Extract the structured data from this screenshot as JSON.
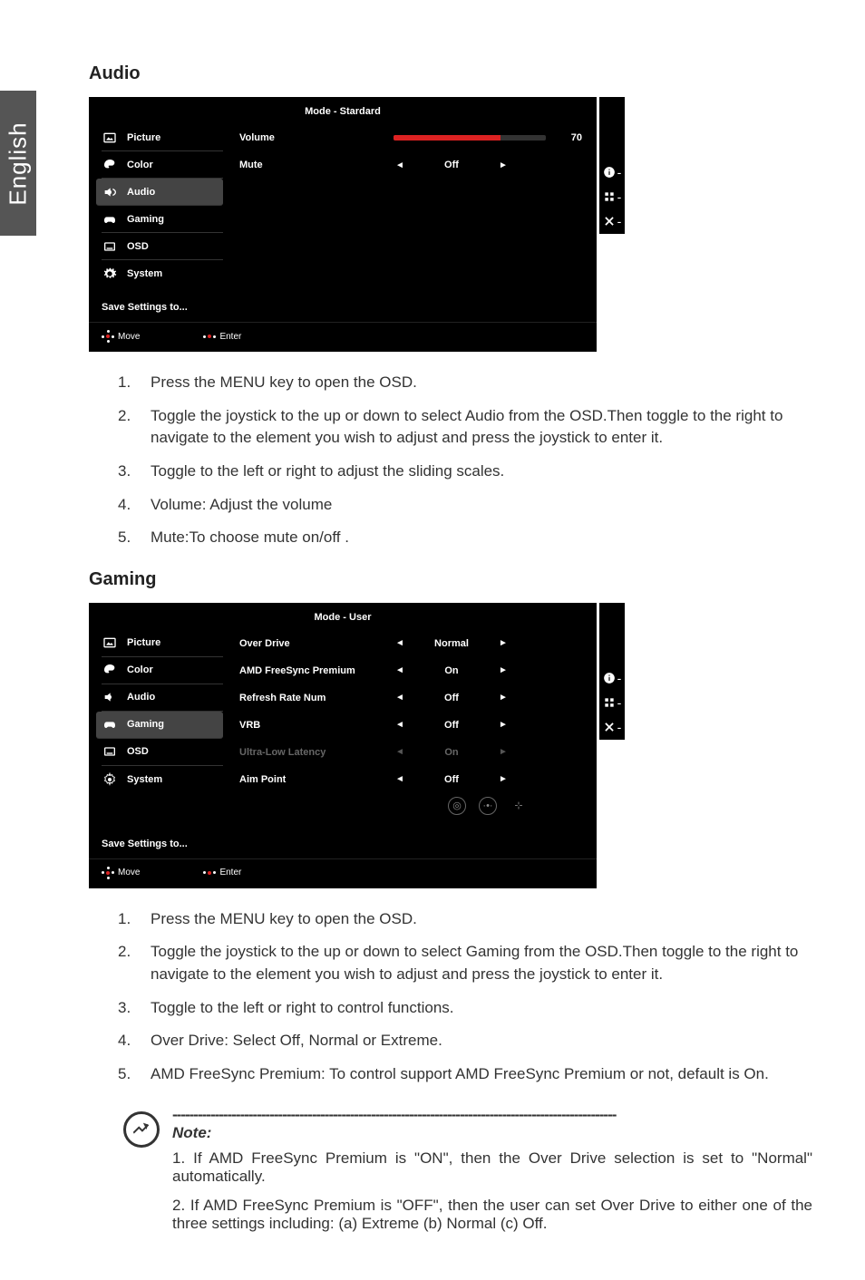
{
  "side_tab": "English",
  "audio_section": {
    "title": "Audio",
    "osd": {
      "mode": "Mode - Stardard",
      "menu": [
        {
          "name": "picture",
          "label": "Picture"
        },
        {
          "name": "color",
          "label": "Color"
        },
        {
          "name": "audio",
          "label": "Audio",
          "selected": true
        },
        {
          "name": "gaming",
          "label": "Gaming"
        },
        {
          "name": "osd",
          "label": "OSD"
        },
        {
          "name": "system",
          "label": "System"
        }
      ],
      "rows": {
        "volume": {
          "label": "Volume",
          "value": "70",
          "percent": 70
        },
        "mute": {
          "label": "Mute",
          "left": "◄",
          "value": "Off",
          "right": "►"
        }
      },
      "save": "Save Settings to...",
      "footer": {
        "move": "Move",
        "enter": "Enter"
      }
    },
    "steps": [
      "Press the MENU key to open the OSD.",
      "Toggle the joystick to the up or down to select Audio from the OSD.Then toggle to the right to navigate to the element you wish to adjust and press the joystick to enter it.",
      "Toggle to the left or right to adjust the sliding scales.",
      "Volume: Adjust the volume",
      "Mute:To choose mute on/off ."
    ]
  },
  "gaming_section": {
    "title": "Gaming",
    "osd": {
      "mode": "Mode - User",
      "menu": [
        {
          "name": "picture",
          "label": "Picture"
        },
        {
          "name": "color",
          "label": "Color"
        },
        {
          "name": "audio",
          "label": "Audio"
        },
        {
          "name": "gaming",
          "label": "Gaming",
          "selected": true
        },
        {
          "name": "osd",
          "label": "OSD"
        },
        {
          "name": "system",
          "label": "System"
        }
      ],
      "rows": {
        "over_drive": {
          "label": "Over Drive",
          "left": "◄",
          "value": "Normal",
          "right": "►"
        },
        "freesync": {
          "label": "AMD FreeSync Premium",
          "left": "◄",
          "value": "On",
          "right": "►"
        },
        "refresh": {
          "label": "Refresh Rate Num",
          "left": "◄",
          "value": "Off",
          "right": "►"
        },
        "vrb": {
          "label": "VRB",
          "left": "◄",
          "value": "Off",
          "right": "►"
        },
        "ull": {
          "label": "Ultra-Low Latency",
          "left": "◄",
          "value": "On",
          "right": "►",
          "dim": true
        },
        "aim": {
          "label": "Aim Point",
          "left": "◄",
          "value": "Off",
          "right": "►"
        }
      },
      "save": "Save Settings to...",
      "footer": {
        "move": "Move",
        "enter": "Enter"
      }
    },
    "steps": [
      "Press the MENU key to open the OSD.",
      "Toggle the joystick to the up or down to select Gaming from the OSD.Then toggle to the right to navigate to the element you wish to adjust and press the joystick to enter it.",
      "Toggle to the left or right to control functions.",
      "Over Drive: Select Off, Normal or Extreme.",
      "AMD FreeSync Premium: To control support AMD FreeSync Premium or not, default is On."
    ]
  },
  "note": {
    "dashes": "---------------------------------------------------------------------------------------------------------",
    "title": "Note:",
    "p1": "1. If AMD FreeSync Premium is \"ON\", then the Over Drive selection is set to \"Normal\" automatically.",
    "p2": "2. If AMD FreeSync Premium is \"OFF\", then the user can set Over Drive to either one of the three settings including: (a) Extreme (b) Normal (c) Off."
  }
}
